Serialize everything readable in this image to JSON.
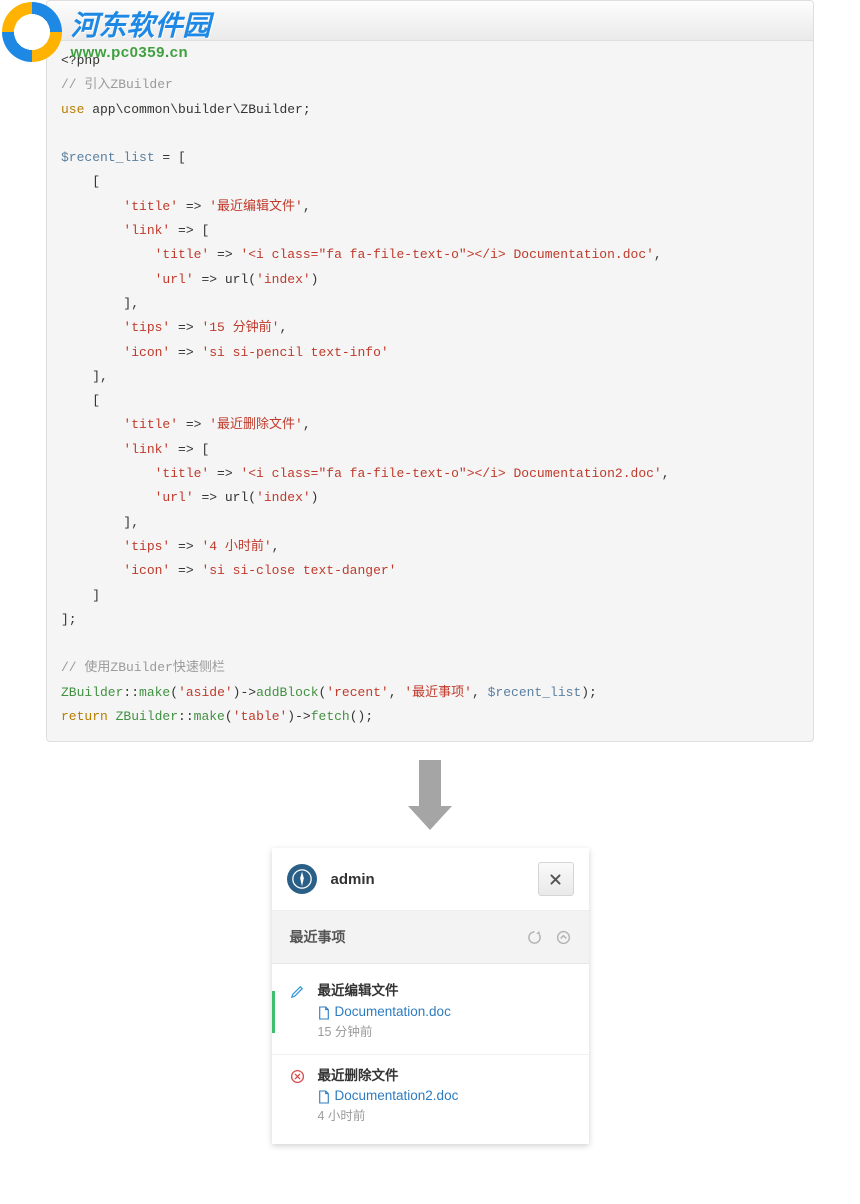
{
  "watermark": {
    "title_cn": "河东软件园",
    "url": "www.pc0359.cn"
  },
  "code": {
    "c1": "// 引入ZBuilder",
    "kw_use": "use",
    "ns": " app\\common\\builder\\ZBuilder;",
    "var_recent": "$recent_list",
    "assign": " = [",
    "open_b1": "    [",
    "k_title": "'title'",
    "arrow": " => ",
    "s_title1": "'最近编辑文件'",
    "k_link": "'link'",
    "link_open": " => [",
    "s_linktitle1": "'<i class=\"fa fa-file-text-o\"></i> Documentation.doc'",
    "k_url": "'url'",
    "url_call": " => url(",
    "s_index": "'index'",
    "paren_close": ")",
    "close_link": "        ],",
    "k_tips": "'tips'",
    "s_tips1": "'15 分钟前'",
    "k_icon": "'icon'",
    "s_icon1": "'si si-pencil text-info'",
    "close_b1": "    ],",
    "s_title2": "'最近删除文件'",
    "s_linktitle2": "'<i class=\"fa fa-file-text-o\"></i> Documentation2.doc'",
    "s_tips2": "'4 小时前'",
    "s_icon2": "'si si-close text-danger'",
    "close_b2": "    ]",
    "close_all": "];",
    "c2": "// 使用ZBuilder快速侧栏",
    "cls": "ZBuilder",
    "dcolon": "::",
    "m_make": "make",
    "s_aside": "'aside'",
    "arrow_op": "->",
    "m_addBlock": "addBlock",
    "s_recent": "'recent'",
    "s_block_title": "'最近事项'",
    "var_recent2": "$recent_list",
    "semi": ";",
    "kw_return": "return",
    "s_table": "'table'",
    "m_fetch": "fetch",
    "empty_paren": "()",
    "comma": ",",
    "sp": " ",
    "indent2": "        ",
    "indent3": "            ",
    "open_paren": "(",
    "close_paren_s": ");"
  },
  "panel": {
    "username": "admin",
    "section_title": "最近事项",
    "items": [
      {
        "title": "最近编辑文件",
        "link": "Documentation.doc",
        "tips": "15 分钟前",
        "icon": "pencil",
        "icon_class": "text-info"
      },
      {
        "title": "最近删除文件",
        "link": "Documentation2.doc",
        "tips": "4 小时前",
        "icon": "close-circle",
        "icon_class": "text-danger"
      }
    ]
  }
}
